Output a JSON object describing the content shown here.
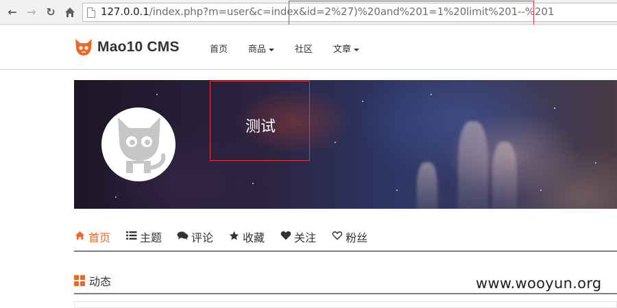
{
  "browser": {
    "url_host": "127.0.0.1",
    "url_path": "/index.php?m=user&c=index&id=2%27)%20and%201=1%20limit%201--%201"
  },
  "site": {
    "logo_text": "Mao10 CMS",
    "nav": [
      {
        "label": "首页",
        "has_dropdown": false
      },
      {
        "label": "商品",
        "has_dropdown": true
      },
      {
        "label": "社区",
        "has_dropdown": false
      },
      {
        "label": "文章",
        "has_dropdown": true
      }
    ]
  },
  "profile": {
    "username": "测试",
    "tabs": [
      {
        "label": "首页",
        "icon": "home-icon",
        "active": true
      },
      {
        "label": "主题",
        "icon": "list-icon",
        "active": false
      },
      {
        "label": "评论",
        "icon": "comments-icon",
        "active": false
      },
      {
        "label": "收藏",
        "icon": "star-icon",
        "active": false
      },
      {
        "label": "关注",
        "icon": "heart-icon",
        "active": false
      },
      {
        "label": "粉丝",
        "icon": "heart-outline-icon",
        "active": false
      }
    ]
  },
  "activity": {
    "title": "动态"
  },
  "watermark": "www.wooyun.org",
  "colors": {
    "accent": "#f26522",
    "highlight_box": "#e8333a"
  }
}
